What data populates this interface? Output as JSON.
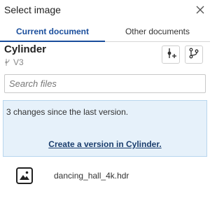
{
  "dialog": {
    "title": "Select image",
    "close_icon": "close-icon"
  },
  "tabs": [
    {
      "label": "Current document",
      "active": true
    },
    {
      "label": "Other documents",
      "active": false
    }
  ],
  "document": {
    "name": "Cylinder",
    "version": "V3",
    "version_icon": "version-graph-icon"
  },
  "toolbar": {
    "create_version_icon": "create-version-icon",
    "branch_icon": "branch-icon"
  },
  "search": {
    "placeholder": "Search files",
    "value": ""
  },
  "notice": {
    "message": "3 changes since the last version.",
    "link": "Create a version in Cylinder.",
    "bg_color": "#e6f1fa"
  },
  "files": [
    {
      "name": "dancing_hall_4k.hdr",
      "icon": "image-file-icon"
    }
  ],
  "colors": {
    "accent": "#1a4e9c"
  }
}
